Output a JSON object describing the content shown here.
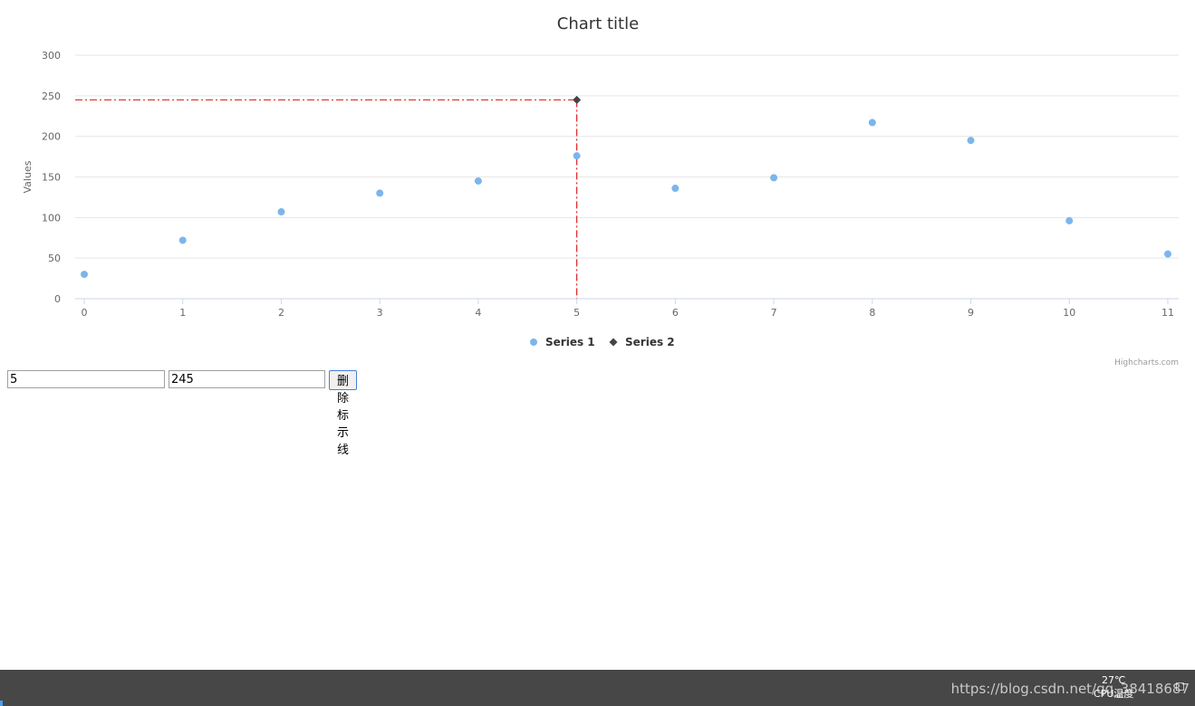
{
  "chart_data": {
    "type": "scatter",
    "title": "Chart title",
    "ylabel": "Values",
    "xlabel": "",
    "xlim": [
      0,
      11
    ],
    "ylim": [
      0,
      300
    ],
    "x_ticks": [
      0,
      1,
      2,
      3,
      4,
      5,
      6,
      7,
      8,
      9,
      10,
      11
    ],
    "y_ticks": [
      0,
      50,
      100,
      150,
      200,
      250,
      300
    ],
    "grid": true,
    "legend_position": "bottom-center",
    "credits": "Highcharts.com",
    "series": [
      {
        "name": "Series 1",
        "color": "#7cb5ec",
        "marker": "circle",
        "points": [
          [
            0,
            30
          ],
          [
            1,
            72
          ],
          [
            2,
            107
          ],
          [
            3,
            130
          ],
          [
            4,
            145
          ],
          [
            5,
            176
          ],
          [
            6,
            136
          ],
          [
            7,
            149
          ],
          [
            8,
            217
          ],
          [
            9,
            195
          ],
          [
            10,
            96
          ],
          [
            11,
            55
          ]
        ]
      },
      {
        "name": "Series 2",
        "color": "#434348",
        "marker": "diamond",
        "points": [
          [
            5,
            245
          ]
        ]
      }
    ],
    "marker_lines": {
      "color": "#e02020",
      "style": "dash-dot",
      "x": 5,
      "y": 245
    }
  },
  "controls": {
    "x_value": "5",
    "y_value": "245",
    "remove_button_label": "删除标示线"
  },
  "taskbar": {
    "watermark": "https://blog.csdn.net/qq_38418687",
    "cpu_temp": "27℃",
    "cpu_label": "CPU温度",
    "tray_icon": "tray-window-icon"
  }
}
